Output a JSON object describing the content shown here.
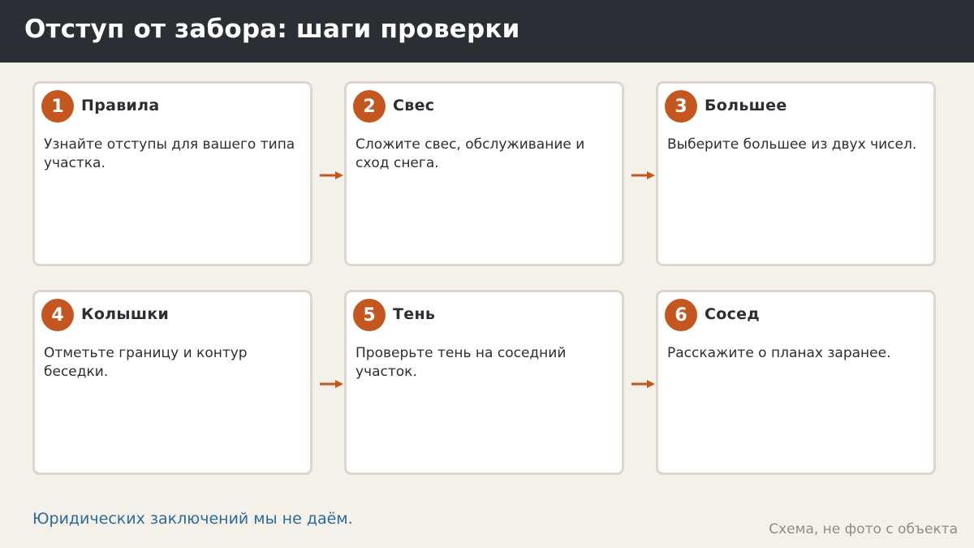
{
  "header": {
    "title": "Отступ от забора: шаги проверки"
  },
  "steps": [
    {
      "number": "1",
      "title": "Правила",
      "text": "Узнайте отступы для вашего типа участка."
    },
    {
      "number": "2",
      "title": "Свес",
      "text": "Сложите свес, обслуживание и сход снега."
    },
    {
      "number": "3",
      "title": "Большее",
      "text": "Выберите большее из двух чисел."
    },
    {
      "number": "4",
      "title": "Колышки",
      "text": "Отметьте границу и контур беседки."
    },
    {
      "number": "5",
      "title": "Тень",
      "text": "Проверьте тень на соседний участок."
    },
    {
      "number": "6",
      "title": "Сосед",
      "text": "Расскажите о планах заранее."
    }
  ],
  "footer": {
    "note": "Юридических заключений мы не даём.",
    "caption": "Схема, не фото с объекта"
  },
  "colors": {
    "header_bg": "#2b2e33",
    "accent": "#c4571f",
    "card_border": "#ddd6cc",
    "note": "#2e6a96"
  },
  "icons": {
    "connector": "arrow-right-icon"
  }
}
